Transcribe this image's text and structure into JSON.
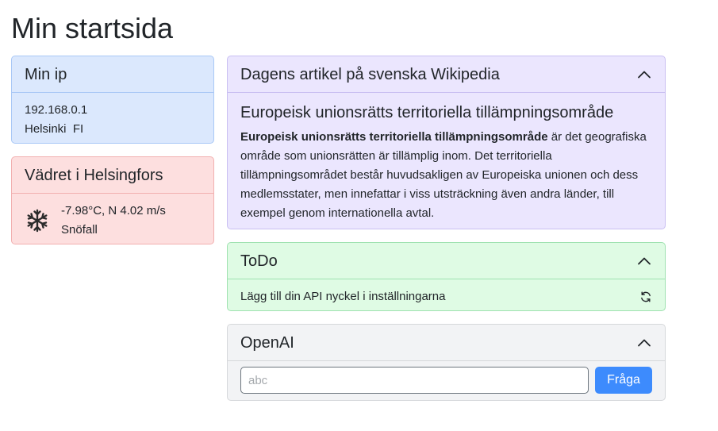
{
  "page": {
    "title": "Min startsida"
  },
  "ip_card": {
    "title": "Min ip",
    "ip": "192.168.0.1",
    "location": "Helsinki  FI"
  },
  "weather_card": {
    "title": "Vädret i Helsingfors",
    "reading": "-7.98°C, N 4.02 m/s",
    "condition": "Snöfall",
    "icon": "snowflake-icon"
  },
  "wiki_card": {
    "title": "Dagens artikel på svenska Wikipedia",
    "article_title": "Europeisk unionsrätts territoriella tillämpningsområde",
    "article_bold": "Europeisk unionsrätts territoriella tillämpningsområde",
    "article_text": " är det geografiska område som unionsrätten är tillämplig inom. Det territoriella tillämpningsområdet består huvudsakligen av Europeiska unionen och dess medlemsstater, men innefattar i viss utsträckning även andra länder, till exempel genom internationella avtal."
  },
  "todo_card": {
    "title": "ToDo",
    "message": "Lägg till din API nyckel i inställningarna"
  },
  "openai_card": {
    "title": "OpenAI",
    "input_placeholder": "abc",
    "input_value": "",
    "button_label": "Fråga"
  },
  "colors": {
    "ip_card_bg": "#dbe8fd",
    "weather_card_bg": "#fddfdf",
    "wiki_card_bg": "#ebe6fe",
    "todo_card_bg": "#dffbe4",
    "openai_card_bg": "#f2f3f5",
    "button_primary": "#3d8bfd"
  }
}
